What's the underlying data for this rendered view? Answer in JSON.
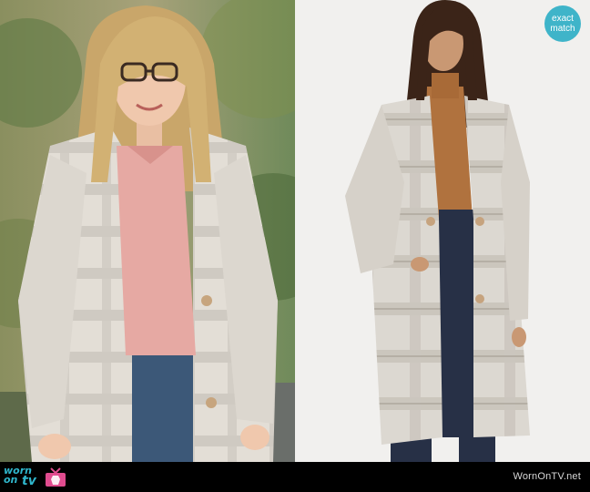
{
  "images": {
    "left": {
      "alt": "Woman with glasses wearing a grey plaid open-front coat over a pink sweater and jeans"
    },
    "right": {
      "alt": "Model wearing a grey plaid long coat over a camel turtleneck and navy trousers"
    }
  },
  "badge": {
    "line1": "exact",
    "line2": "match",
    "color": "#3fb4c9"
  },
  "logo": {
    "line1": "worn",
    "line2": "on",
    "line3": "tv",
    "color": "#2fb6cc"
  },
  "credit": {
    "text": "WornOnTV.net"
  },
  "colors": {
    "footer": "#000000",
    "coat": "#d6d1c9",
    "sweater_pink": "#e6a9a3",
    "turtleneck": "#b0723e",
    "trousers": "#273046"
  }
}
